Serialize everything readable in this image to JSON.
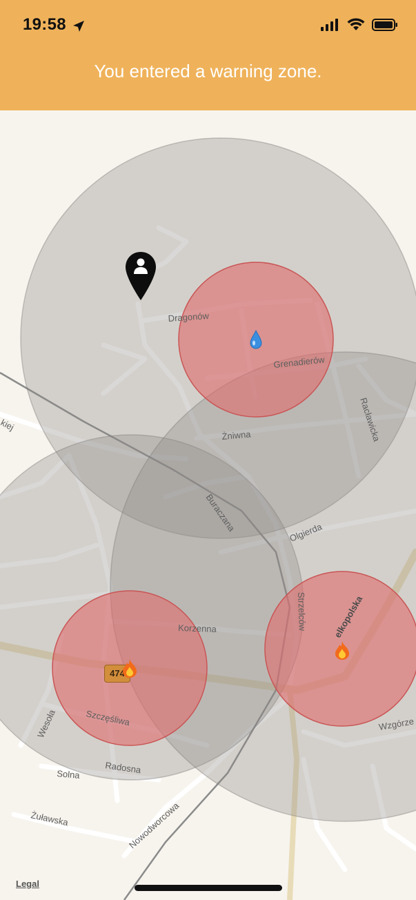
{
  "status_bar": {
    "time": "19:58"
  },
  "banner": {
    "message": "You entered a warning zone."
  },
  "map": {
    "legal_label": "Legal",
    "route_number": "474",
    "streets": {
      "dragonow": "Dragonów",
      "grenadierow": "Grenadierów",
      "raclawicka": "Racławicka",
      "zniwna": "Żniwna",
      "buraczana": "Buraczana",
      "olgierda": "Olgierda",
      "strzelcow": "Strzelców",
      "wielkopolska": "elkopolska",
      "korzenna": "Korzenna",
      "szczesliwa": "Szczęśliwa",
      "wesola": "Wesoła",
      "solna": "Solna",
      "radosna": "Radosna",
      "zulawska": "Żuławska",
      "nowodworcowa": "Nowodworcowa",
      "wzgorze": "Wzgórze",
      "kiej": "kiej"
    },
    "zones": [
      {
        "kind": "warning",
        "color": "#9a9a9a"
      },
      {
        "kind": "danger",
        "icon": "water-drop-icon",
        "color": "#e06a6a"
      },
      {
        "kind": "danger",
        "icon": "fire-icon",
        "color": "#e06a6a"
      },
      {
        "kind": "danger",
        "icon": "fire-icon",
        "color": "#e06a6a"
      }
    ]
  },
  "colors": {
    "banner": "#efb25a",
    "danger_zone": "#e06a6a",
    "warning_zone": "#9a9a9a"
  }
}
